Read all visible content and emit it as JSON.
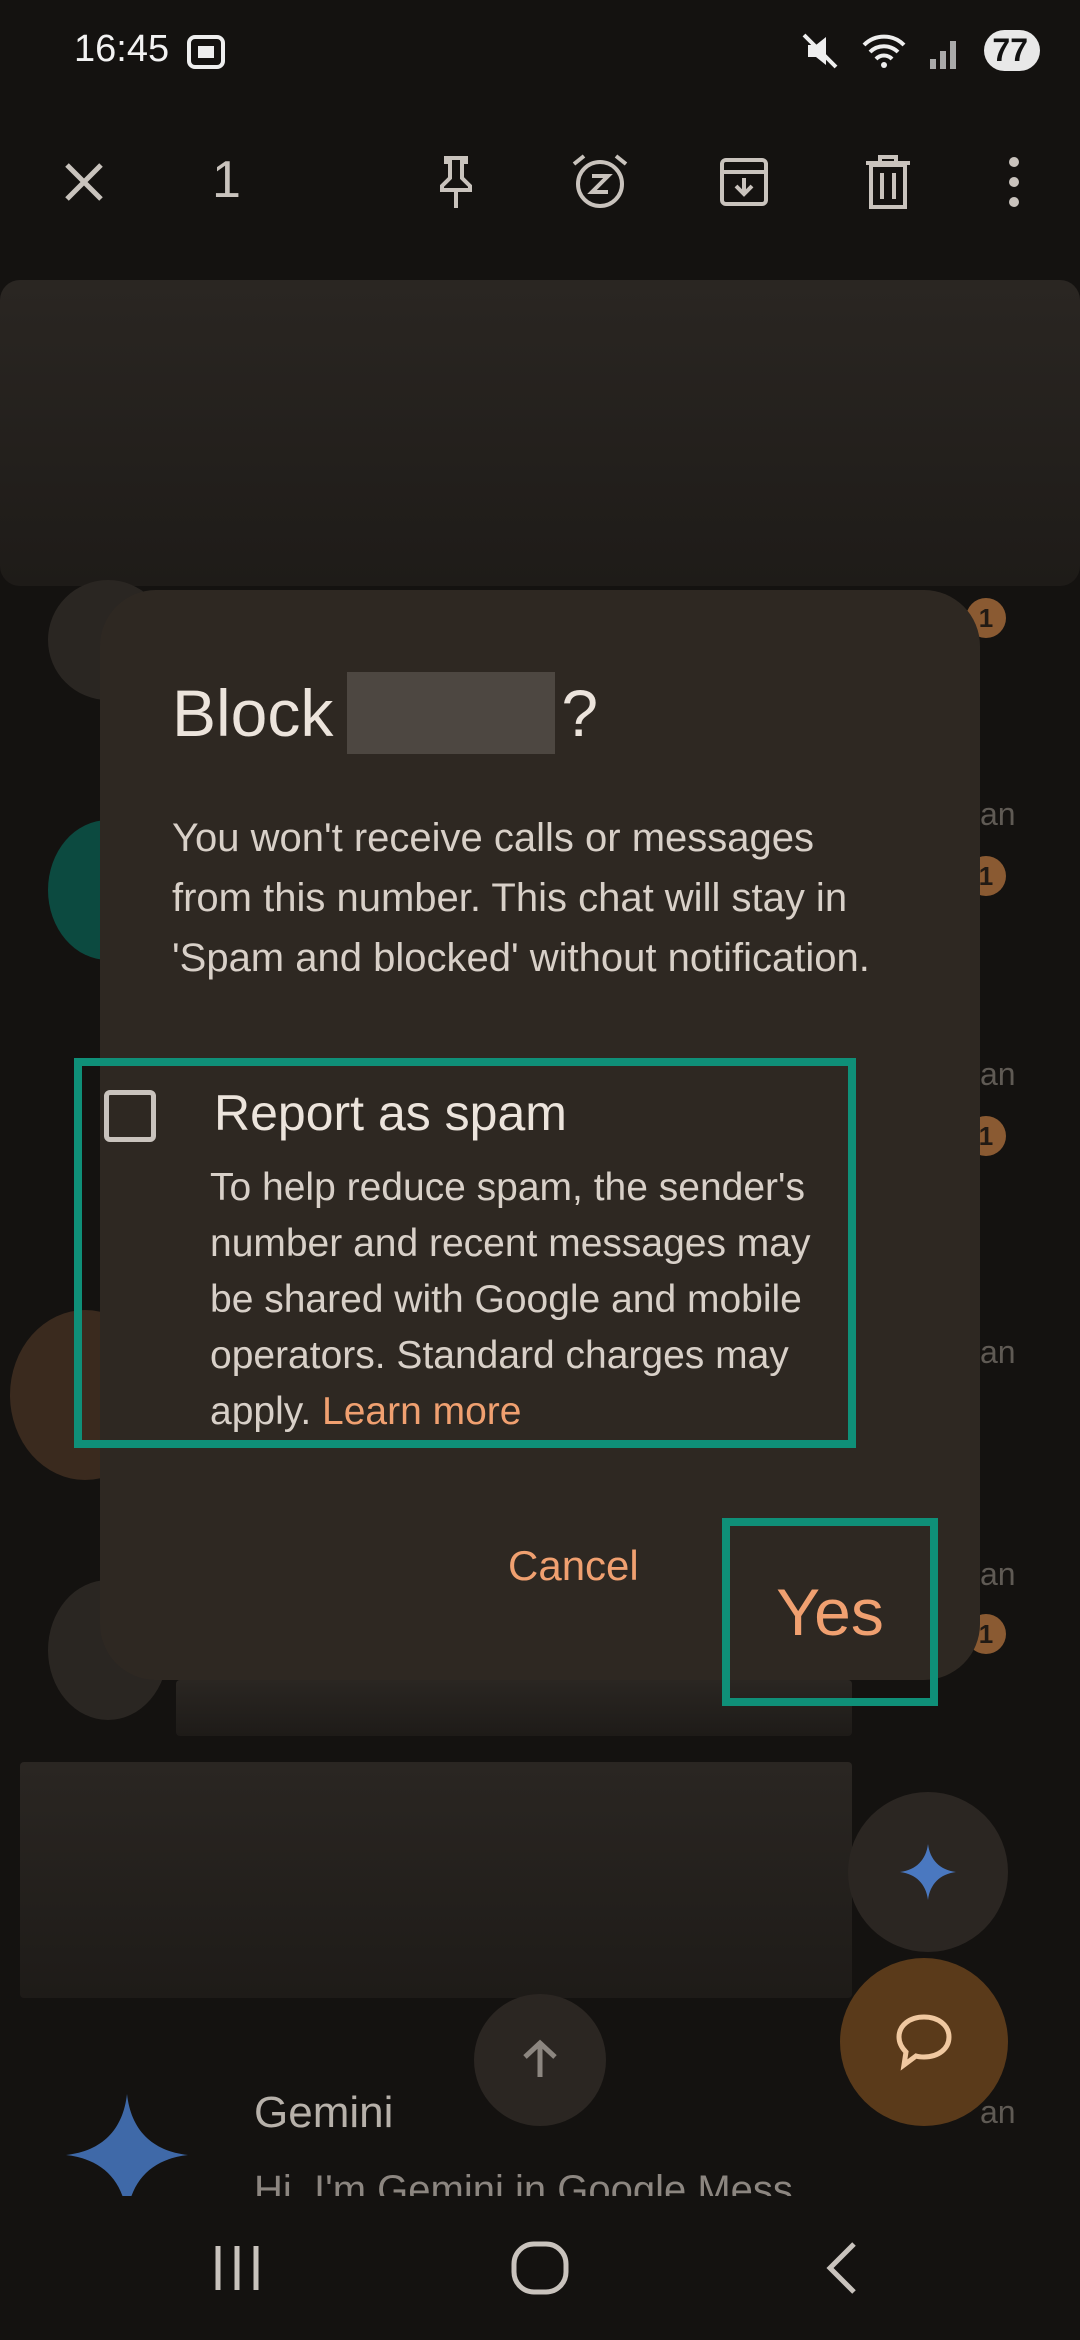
{
  "status_bar": {
    "time": "16:45",
    "battery": "77"
  },
  "toolbar": {
    "selected_count": "1",
    "icons": [
      "close-icon",
      "pin-icon",
      "snooze-icon",
      "archive-icon",
      "delete-icon",
      "more-icon"
    ]
  },
  "background_list": {
    "badges": [
      "1",
      "1",
      "1",
      "1"
    ],
    "side_texts": [
      "an",
      "an",
      "an",
      "an",
      "an"
    ]
  },
  "dialog": {
    "title_prefix": "Block",
    "title_suffix": "?",
    "body": "You won't receive calls or messages from this number. This chat will stay in 'Spam and blocked' without notification.",
    "report_spam": {
      "label": "Report as spam",
      "checked": false,
      "description": "To help reduce spam, the sender's number and recent messages may be shared with Google and mobile operators. Standard charges may apply.",
      "learn_more": "Learn more"
    },
    "cancel_label": "Cancel",
    "yes_label": "Yes"
  },
  "gemini_row": {
    "name": "Gemini",
    "message": "Hi, I'm Gemini in Google Mess..."
  },
  "colors": {
    "accent": "#f0a070",
    "highlight": "#0f8f78",
    "dialog_bg": "#2e2822"
  }
}
